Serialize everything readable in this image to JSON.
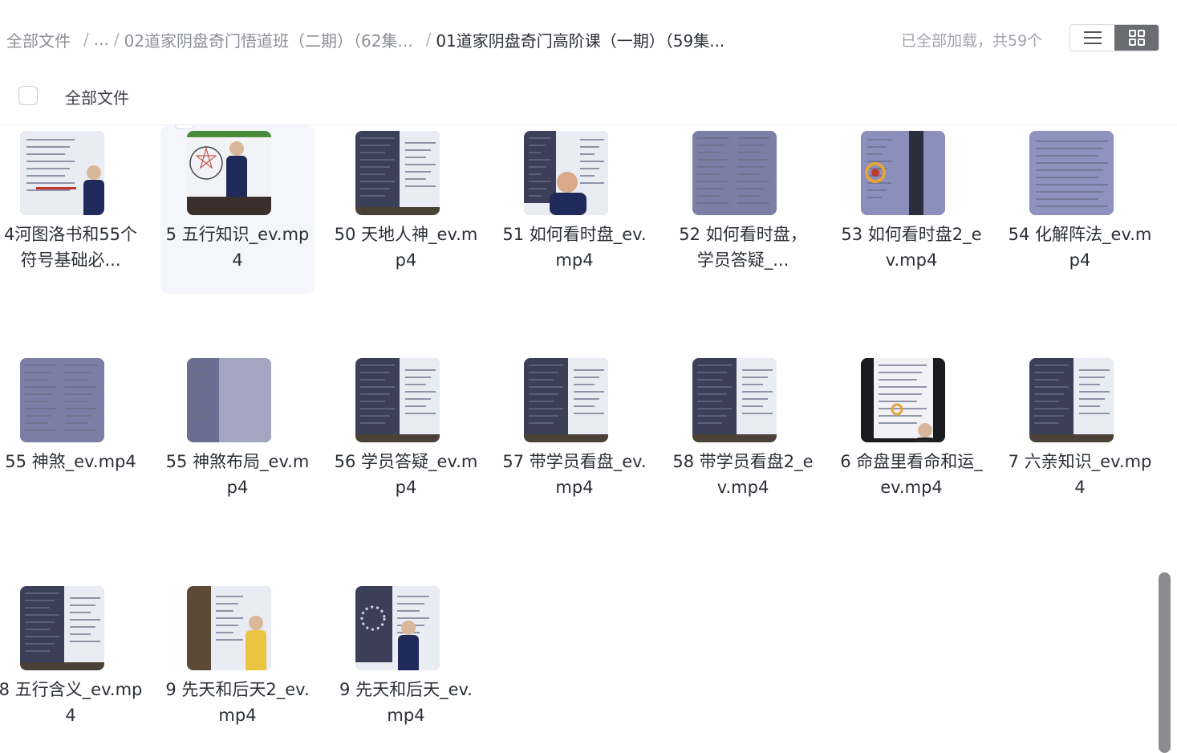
{
  "breadcrumb": {
    "items": [
      "全部文件",
      "...",
      "02道家阴盘奇门悟道班（二期）（62集...",
      "01道家阴盘奇门高阶课（一期）（59集..."
    ],
    "separator": "/"
  },
  "status": "已全部加载，共59个",
  "view_toggle": {
    "list_icon": "list-icon",
    "grid_icon": "grid-icon",
    "active": "grid"
  },
  "subheader": {
    "label": "全部文件"
  },
  "files": [
    {
      "name": "4河图洛书和55个符号基础必...",
      "thumb": "whiteboard-teacher"
    },
    {
      "name": "5 五行知识_ev.mp4",
      "thumb": "whiteboard-star",
      "hover": true
    },
    {
      "name": "50 天地人神_ev.mp4",
      "thumb": "screen-whiteboard"
    },
    {
      "name": "51 如何看时盘_ev.mp4",
      "thumb": "speaker-face"
    },
    {
      "name": "52 如何看时盘，学员答疑_...",
      "thumb": "screen-chart"
    },
    {
      "name": "53 如何看时盘2_ev.mp4",
      "thumb": "screen-circle"
    },
    {
      "name": "54 化解阵法_ev.mp4",
      "thumb": "screen-text"
    },
    {
      "name": "55 神煞_ev.mp4",
      "thumb": "screen-chart"
    },
    {
      "name": "55 神煞布局_ev.mp4",
      "thumb": "screen-blank"
    },
    {
      "name": "56 学员答疑_ev.mp4",
      "thumb": "screen-whiteboard"
    },
    {
      "name": "57 带学员看盘_ev.mp4",
      "thumb": "screen-whiteboard"
    },
    {
      "name": "58 带学员看盘2_ev.mp4",
      "thumb": "screen-whiteboard"
    },
    {
      "name": "6 命盘里看命和运_ev.mp4",
      "thumb": "phone-chart"
    },
    {
      "name": "7 六亲知识_ev.mp4",
      "thumb": "screen-whiteboard"
    },
    {
      "name": "8 五行含义_ev.mp4",
      "thumb": "screen-whiteboard"
    },
    {
      "name": "9 先天和后天2_ev.mp4",
      "thumb": "whiteboard-teacher-yellow"
    },
    {
      "name": "9 先天和后天_ev.mp4",
      "thumb": "screen-circle-teacher"
    }
  ],
  "colors": {
    "board": "#e9ecf3",
    "screen": "#3b3f58",
    "robe": "#1f2a5a",
    "hover_bg": "#f4f6fb",
    "scroll_thumb": "#8a8c90"
  }
}
